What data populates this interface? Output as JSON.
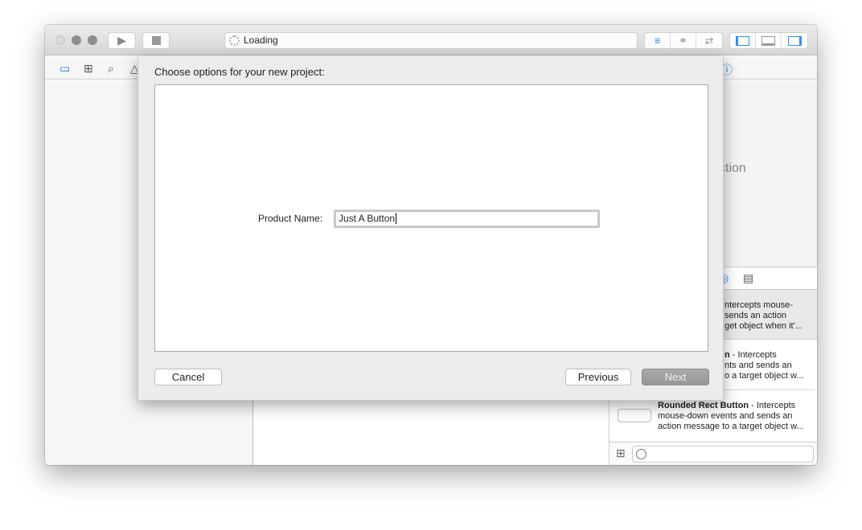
{
  "toolbar": {
    "activity_text": "Loading",
    "run": "run",
    "stop": "stop"
  },
  "sheet": {
    "title": "Choose options for your new project:",
    "product_name_label": "Product Name:",
    "product_name_value": "Just A Button",
    "cancel": "Cancel",
    "previous": "Previous",
    "next": "Next"
  },
  "inspector": {
    "partial_text": "ction"
  },
  "library": {
    "items": [
      {
        "lines": [
          "ntercepts mouse-",
          "sends an action",
          "get object when it'..."
        ]
      },
      {
        "title_fragment": "n",
        "desc_lines": [
          " - Intercepts",
          "nts and sends an",
          "o a target object w..."
        ]
      },
      {
        "title": "Rounded Rect Button",
        "desc_first": " - Intercepts",
        "desc_lines": [
          "mouse-down events and sends an",
          "action message to a target object w..."
        ]
      }
    ]
  },
  "colors": {
    "accent": "#1a82f0",
    "next_button": "#9d9d9d",
    "selected_row": "#e8e8e8"
  }
}
